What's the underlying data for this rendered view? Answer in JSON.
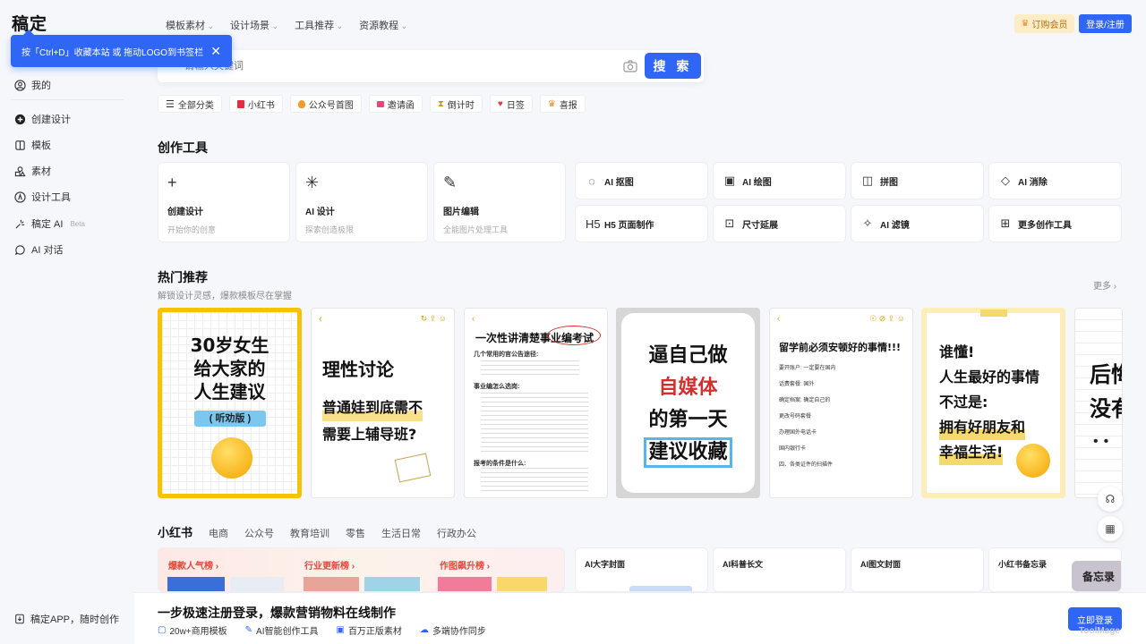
{
  "app": {
    "logo": "稿定"
  },
  "tooltip": {
    "text": "按「Ctrl+D」收藏本站 或 拖动LOGO到书签栏",
    "close": "✕"
  },
  "sidebar": {
    "items": [
      {
        "label": "我的",
        "icon": "user-icon"
      },
      {
        "label": "创建设计",
        "icon": "plus-circle-icon"
      },
      {
        "label": "模板",
        "icon": "template-icon"
      },
      {
        "label": "素材",
        "icon": "shapes-icon"
      },
      {
        "label": "设计工具",
        "icon": "compass-icon"
      },
      {
        "label": "稿定 AI",
        "icon": "ai-sparkle-icon",
        "badge": "Beta"
      },
      {
        "label": "AI 对话",
        "icon": "chat-icon"
      }
    ],
    "app_download": "稿定APP，随时创作"
  },
  "topnav": {
    "items": [
      "模板素材",
      "设计场景",
      "工具推荐",
      "资源教程"
    ],
    "vip": "订购会员",
    "login": "登录/注册"
  },
  "search": {
    "placeholder": "请输入关键词",
    "button": "搜 索"
  },
  "categories": [
    {
      "label": "全部分类",
      "color": "#555555"
    },
    {
      "label": "小红书",
      "color": "#e02e3e"
    },
    {
      "label": "公众号首图",
      "color": "#f39a2b"
    },
    {
      "label": "邀请函",
      "color": "#e8467a"
    },
    {
      "label": "倒计时",
      "color": "#e0b84a"
    },
    {
      "label": "日签",
      "color": "#e23a3a"
    },
    {
      "label": "喜报",
      "color": "#e0902b"
    }
  ],
  "creation_tools": {
    "title": "创作工具",
    "big": [
      {
        "icon": "+",
        "title": "创建设计",
        "sub": "开始你的创意"
      },
      {
        "icon": "✳",
        "title": "AI 设计",
        "sub": "探索创造极限"
      },
      {
        "icon": "✎",
        "title": "图片编辑",
        "sub": "全能图片处理工具"
      }
    ],
    "small": [
      {
        "icon": "◌",
        "label": "AI 抠图"
      },
      {
        "icon": "▣",
        "label": "AI 绘图"
      },
      {
        "icon": "◫",
        "label": "拼图"
      },
      {
        "icon": "◇",
        "label": "AI 消除"
      },
      {
        "icon": "H5",
        "label": "H5 页面制作"
      },
      {
        "icon": "⊡",
        "label": "尺寸延展"
      },
      {
        "icon": "✧",
        "label": "AI 滤镜"
      },
      {
        "icon": "⊞",
        "label": "更多创作工具"
      }
    ]
  },
  "hot": {
    "title": "热门推荐",
    "subtitle": "解锁设计灵感，爆款模板尽在掌握",
    "more": "更多 ›",
    "cards": [
      {
        "lines": [
          "30岁女生",
          "给大家的",
          "人生建议"
        ],
        "tag": "( 听劝版 )"
      },
      {
        "title": "理性讨论",
        "lines": [
          "普通娃到底需不",
          "需要上辅导班?"
        ]
      },
      {
        "title": "一次性讲清楚事业编考试",
        "items": [
          "几个常用的官公告途径:",
          "事业编怎么选岗:",
          "报考的条件是什么:"
        ]
      },
      {
        "lines": [
          "逼自己做",
          "自媒体",
          "的第一天",
          "建议收藏"
        ]
      },
      {
        "title": "留学前必须安顿好的事情!!!",
        "items": [
          "要开账户: 一定要在国内",
          "话费套餐: 国外",
          "确定档案: 确定自己的",
          "更改号码套餐",
          "办理国外电话卡",
          "国内银行卡",
          "四、各类证件的扫描件"
        ]
      },
      {
        "lines": [
          "谁懂!",
          "人生最好的事情",
          "不过是:",
          "拥有好朋友和",
          "幸福生活!"
        ]
      },
      {
        "lines": [
          "后悔",
          "没有"
        ]
      }
    ]
  },
  "tabs": [
    "小红书",
    "电商",
    "公众号",
    "教育培训",
    "零售",
    "生活日常",
    "行政办公"
  ],
  "bottom_cards": {
    "first": [
      "爆款人气榜 ›",
      "行业更新榜 ›",
      "作图飙升榜 ›"
    ],
    "others": [
      "AI大字封面",
      "AI科普长文",
      "AI图文封面",
      "小红书备忘录"
    ],
    "memo_tag": "备忘录"
  },
  "bottom_bar": {
    "title": "一步极速注册登录，爆款营销物料在线制作",
    "features": [
      "20w+商用模板",
      "AI智能创作工具",
      "百万正版素材",
      "多端协作同步"
    ],
    "button": "立即登录"
  },
  "watermark": "ToolMage"
}
